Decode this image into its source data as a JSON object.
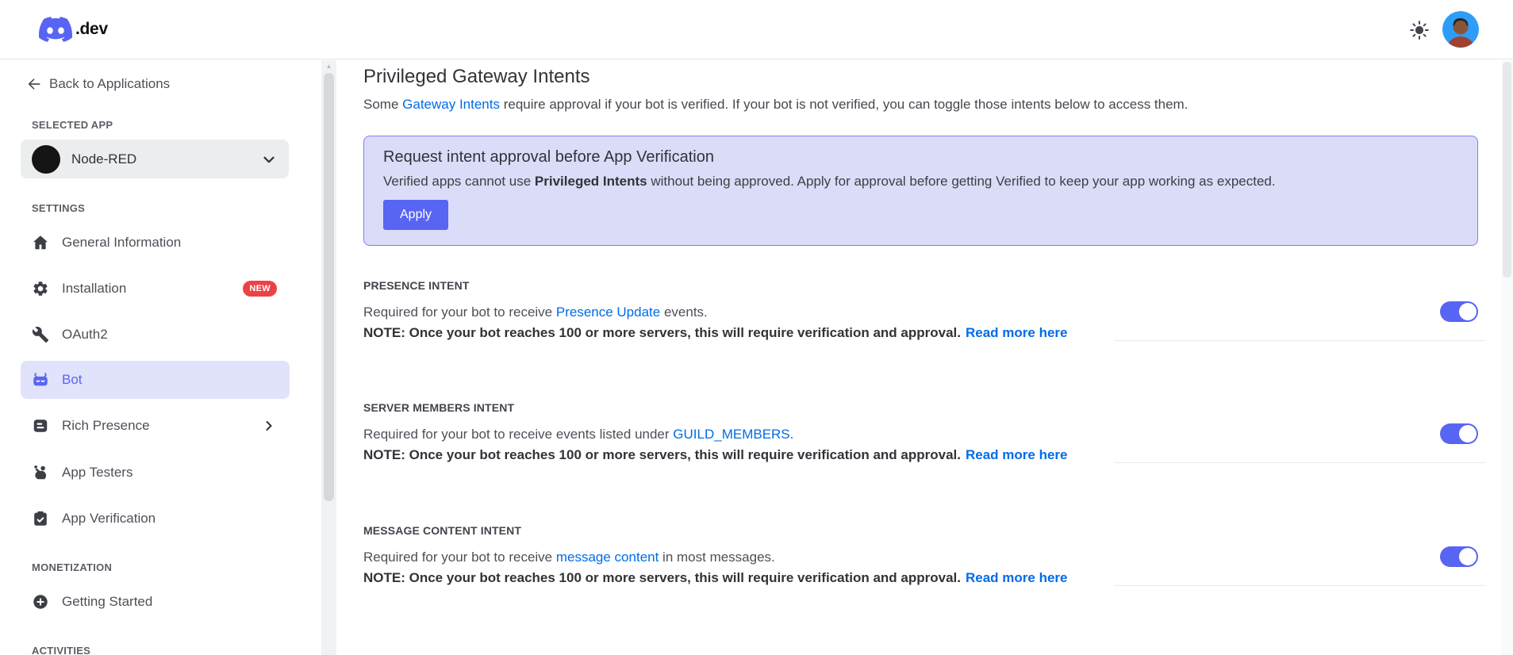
{
  "topbar": {
    "brand_suffix": ".dev"
  },
  "sidebar": {
    "back_label": "Back to Applications",
    "selected_app_label": "SELECTED APP",
    "selected_app": {
      "name": "Node-RED"
    },
    "sections": {
      "settings": "SETTINGS",
      "monetization": "MONETIZATION",
      "activities": "ACTIVITIES"
    },
    "items": [
      {
        "label": "General Information"
      },
      {
        "label": "Installation",
        "badge": "NEW"
      },
      {
        "label": "OAuth2"
      },
      {
        "label": "Bot",
        "selected": true
      },
      {
        "label": "Rich Presence"
      },
      {
        "label": "App Testers"
      },
      {
        "label": "App Verification"
      },
      {
        "label": "Getting Started"
      }
    ]
  },
  "main": {
    "title": "Privileged Gateway Intents",
    "intro": {
      "prefix": "Some ",
      "link": "Gateway Intents",
      "suffix": " require approval if your bot is verified. If your bot is not verified, you can toggle those intents below to access them."
    },
    "callout": {
      "title": "Request intent approval before App Verification",
      "body_prefix": "Verified apps cannot use ",
      "body_bold": "Privileged Intents",
      "body_suffix": " without being approved. Apply for approval before getting Verified to keep your app working as expected.",
      "apply_label": "Apply"
    },
    "intents": [
      {
        "label": "PRESENCE INTENT",
        "desc_prefix": "Required for your bot to receive ",
        "desc_link": "Presence Update",
        "desc_suffix": " events.",
        "note": "NOTE: Once your bot reaches 100 or more servers, this will require verification and approval.",
        "note_link": "Read more here",
        "enabled": true
      },
      {
        "label": "SERVER MEMBERS INTENT",
        "desc_prefix": "Required for your bot to receive events listed under ",
        "desc_link": "GUILD_MEMBERS",
        "desc_suffix": ".",
        "note": "NOTE: Once your bot reaches 100 or more servers, this will require verification and approval.",
        "note_link": "Read more here",
        "enabled": true
      },
      {
        "label": "MESSAGE CONTENT INTENT",
        "desc_prefix": "Required for your bot to receive ",
        "desc_link": "message content",
        "desc_suffix": " in most messages.",
        "note": "NOTE: Once your bot reaches 100 or more servers, this will require verification and approval.",
        "note_link": "Read more here",
        "enabled": true
      }
    ]
  },
  "colors": {
    "accent": "#5865F2",
    "link_blue": "#006CE7",
    "badge_red": "#ED4245",
    "callout_bg": "#DBDCF8",
    "callout_border": "#7D80EF",
    "selected_item_bg": "#E1E2FB"
  }
}
